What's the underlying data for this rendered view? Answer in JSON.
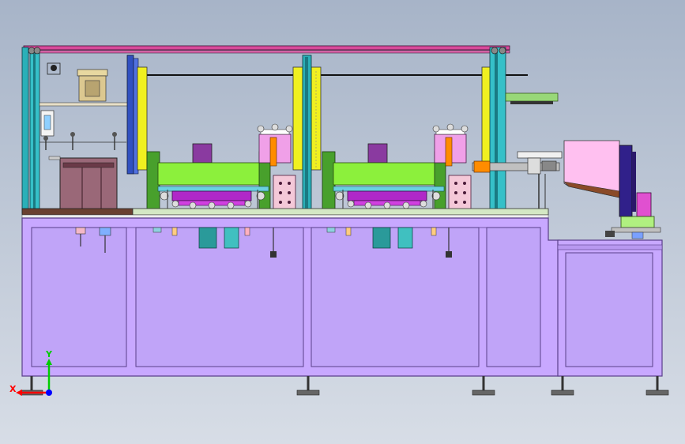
{
  "axis_triad": {
    "x_label": "X",
    "y_label": "Y",
    "x_color": "#ff0000",
    "y_color": "#00cc00",
    "z_color": "#0000ff"
  },
  "colors": {
    "background_top": "#a7b4c8",
    "background_bottom": "#d7dde6",
    "frame_violet": "#c8a8ff",
    "frame_edge": "#5a3f8a",
    "column_teal": "#2ab0b8",
    "top_rail_pink": "#d84a9a",
    "yellow_guard": "#f0f020",
    "lime_carriage": "#8cf03c",
    "magenta_bar": "#b028c8",
    "cylinder_pink": "#f0a0e8",
    "orange_rod": "#ff8c00",
    "hopper_pink": "#ffc0f0",
    "hopper_brown": "#8a4a28",
    "navy_panel": "#30208a",
    "steel_blue": "#3050c0",
    "green_base": "#98d878"
  }
}
